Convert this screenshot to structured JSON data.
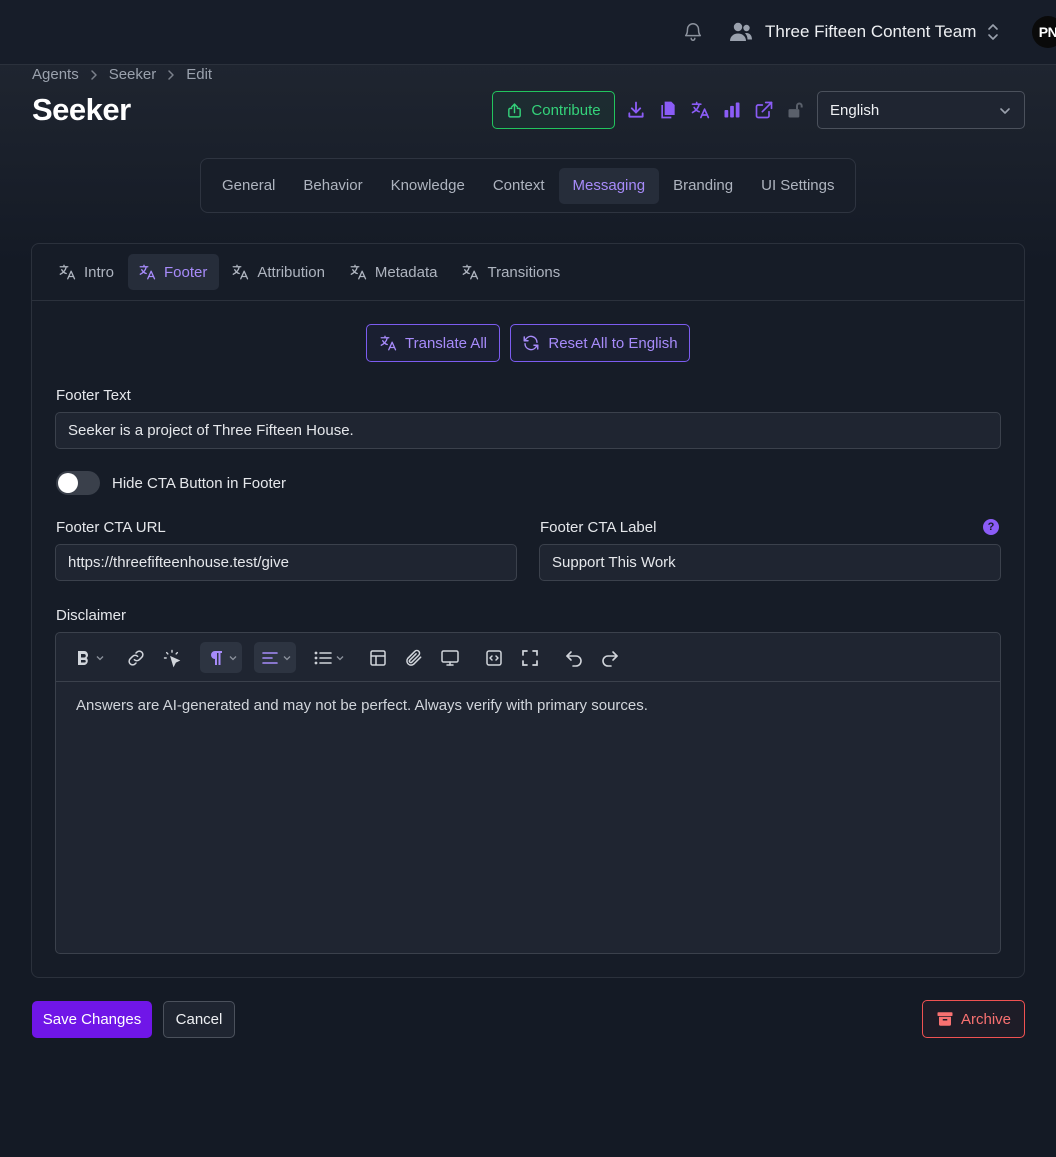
{
  "header": {
    "team_name": "Three Fifteen Content Team",
    "avatar_initials": "PN"
  },
  "breadcrumb": [
    "Agents",
    "Seeker",
    "Edit"
  ],
  "page": {
    "title": "Seeker",
    "contribute_label": "Contribute",
    "language_selected": "English"
  },
  "main_tabs": [
    "General",
    "Behavior",
    "Knowledge",
    "Context",
    "Messaging",
    "Branding",
    "UI Settings"
  ],
  "main_tab_active": "Messaging",
  "sub_tabs": [
    "Intro",
    "Footer",
    "Attribution",
    "Metadata",
    "Transitions"
  ],
  "sub_tab_active": "Footer",
  "actions": {
    "translate_all": "Translate All",
    "reset_all": "Reset All to English"
  },
  "form": {
    "footer_text_label": "Footer Text",
    "footer_text_value": "Seeker is a project of Three Fifteen House.",
    "hide_cta_label": "Hide CTA Button in Footer",
    "hide_cta_on": false,
    "cta_url_label": "Footer CTA URL",
    "cta_url_value": "https://threefifteenhouse.test/give",
    "cta_label_label": "Footer CTA Label",
    "cta_label_value": "Support This Work",
    "help_glyph": "?",
    "disclaimer_label": "Disclaimer",
    "disclaimer_value": "Answers are AI-generated and may not be perfect. Always verify with primary sources."
  },
  "footer_actions": {
    "save": "Save Changes",
    "cancel": "Cancel",
    "archive": "Archive"
  },
  "colors": {
    "accent": "#a78bfa",
    "primary": "#7016e8",
    "success": "#22c55e",
    "danger": "#f05252"
  }
}
